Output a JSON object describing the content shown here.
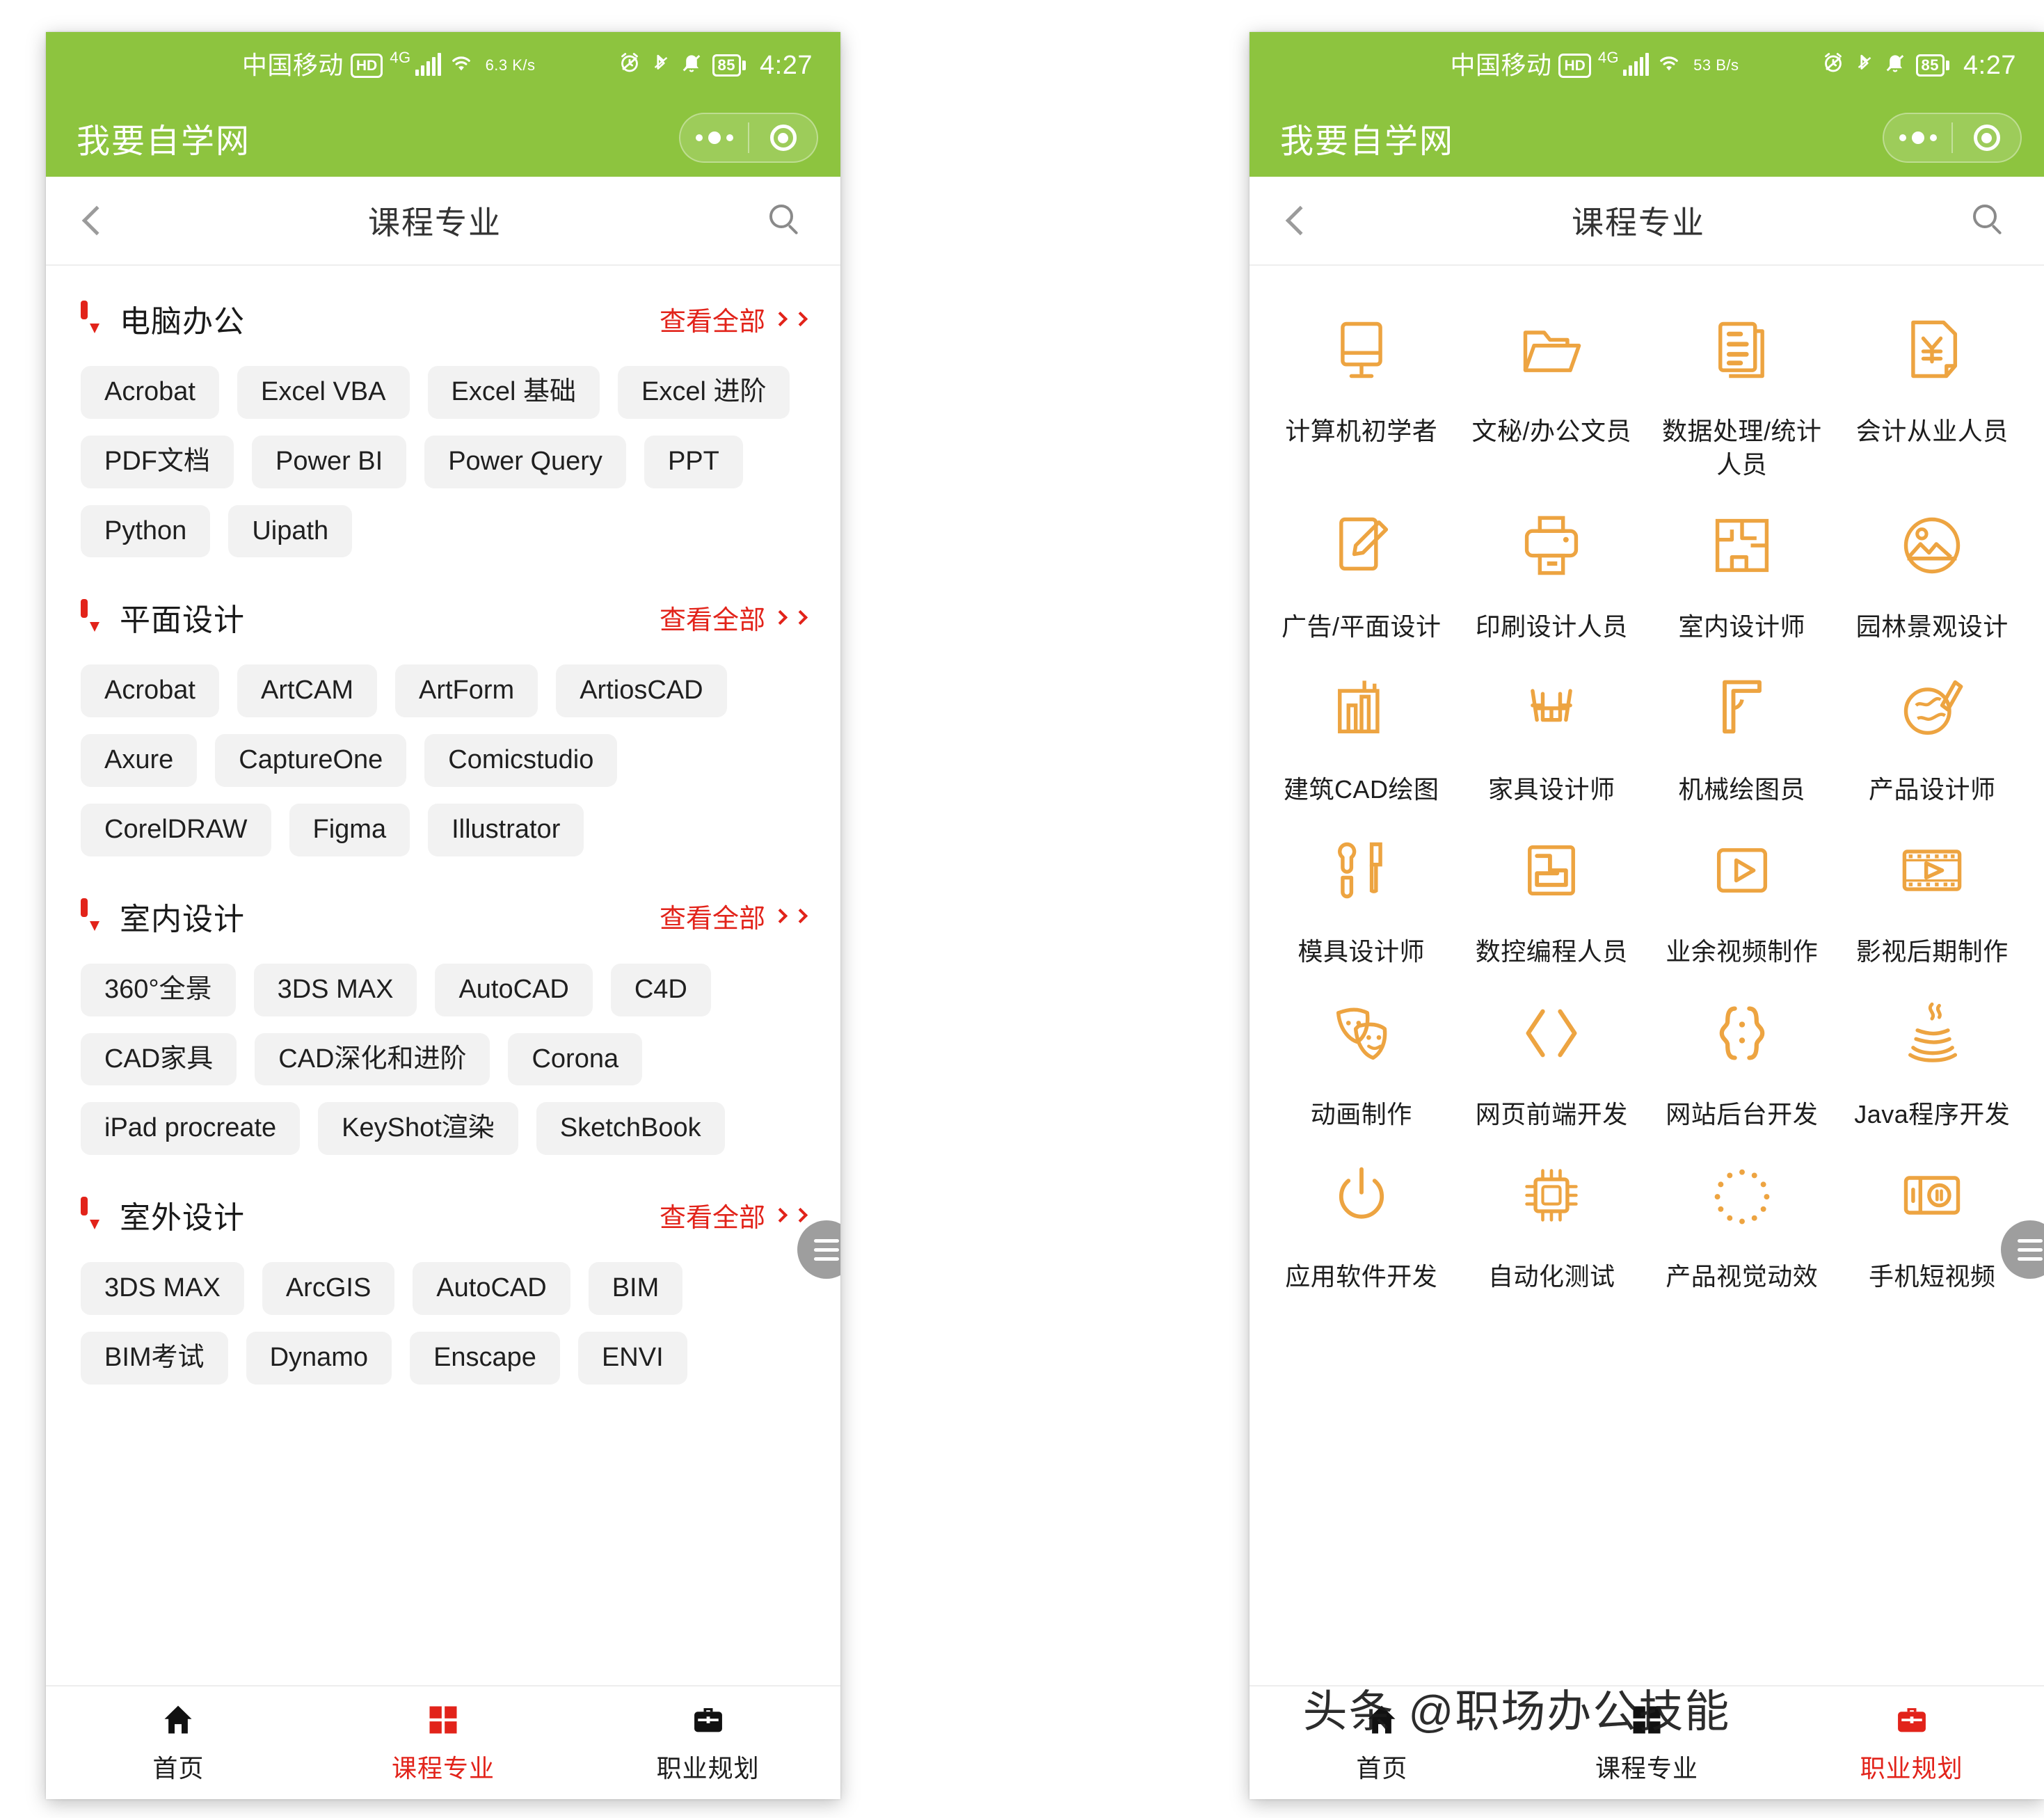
{
  "status_bar": {
    "carrier": "中国移动",
    "hd_badge": "HD",
    "network": "4G",
    "speed_left": "6.3\nK/s",
    "speed_right": "53\nB/s",
    "battery": "85",
    "time": "4:27",
    "icons": [
      "signal-bars-icon",
      "wifi-icon",
      "alarm-icon",
      "bluetooth-icon",
      "mute-icon",
      "battery-icon"
    ]
  },
  "app_bar": {
    "title": "我要自学网",
    "capsule": {
      "more_icon": "more-dots-icon",
      "target_icon": "target-circle-icon"
    }
  },
  "nav_bar": {
    "back_icon": "back-chevron-icon",
    "title": "课程专业",
    "search_icon": "search-icon"
  },
  "left_panel": {
    "see_all_label": "查看全部",
    "sections": [
      {
        "title": "电脑办公",
        "tags": [
          "Acrobat",
          "Excel VBA",
          "Excel 基础",
          "Excel 进阶",
          "PDF文档",
          "Power BI",
          "Power Query",
          "PPT",
          "Python",
          "Uipath"
        ]
      },
      {
        "title": "平面设计",
        "tags": [
          "Acrobat",
          "ArtCAM",
          "ArtForm",
          "ArtiosCAD",
          "Axure",
          "CaptureOne",
          "Comicstudio",
          "CorelDRAW",
          "Figma",
          "Illustrator"
        ]
      },
      {
        "title": "室内设计",
        "tags": [
          "360°全景",
          "3DS MAX",
          "AutoCAD",
          "C4D",
          "CAD家具",
          "CAD深化和进阶",
          "Corona",
          "iPad procreate",
          "KeyShot渲染",
          "SketchBook"
        ]
      },
      {
        "title": "室外设计",
        "tags": [
          "3DS MAX",
          "ArcGIS",
          "AutoCAD",
          "BIM",
          "BIM考试",
          "Dynamo",
          "Enscape",
          "ENVI"
        ]
      }
    ]
  },
  "right_panel": {
    "professions": [
      {
        "label": "计算机初学者",
        "icon": "monitor-icon"
      },
      {
        "label": "文秘/办公文员",
        "icon": "folder-icon"
      },
      {
        "label": "数据处理/统计人员",
        "icon": "document-list-icon"
      },
      {
        "label": "会计从业人员",
        "icon": "invoice-yuan-icon"
      },
      {
        "label": "广告/平面设计",
        "icon": "pencil-edit-icon"
      },
      {
        "label": "印刷设计人员",
        "icon": "printer-icon"
      },
      {
        "label": "室内设计师",
        "icon": "floorplan-icon"
      },
      {
        "label": "园林景观设计",
        "icon": "landscape-picture-icon"
      },
      {
        "label": "建筑CAD绘图",
        "icon": "buildings-chart-icon"
      },
      {
        "label": "家具设计师",
        "icon": "table-chairs-icon"
      },
      {
        "label": "机械绘图员",
        "icon": "set-square-icon"
      },
      {
        "label": "产品设计师",
        "icon": "sketch-pen-icon"
      },
      {
        "label": "模具设计师",
        "icon": "wrench-screwdriver-icon"
      },
      {
        "label": "数控编程人员",
        "icon": "cnc-path-icon"
      },
      {
        "label": "业余视频制作",
        "icon": "play-square-icon"
      },
      {
        "label": "影视后期制作",
        "icon": "film-strip-icon"
      },
      {
        "label": "动画制作",
        "icon": "theater-masks-icon"
      },
      {
        "label": "网页前端开发",
        "icon": "code-brackets-icon"
      },
      {
        "label": "网站后台开发",
        "icon": "curly-braces-icon"
      },
      {
        "label": "Java程序开发",
        "icon": "java-coffee-icon"
      },
      {
        "label": "应用软件开发",
        "icon": "power-button-icon"
      },
      {
        "label": "自动化测试",
        "icon": "chip-icon"
      },
      {
        "label": "产品视觉动效",
        "icon": "dotted-circle-icon"
      },
      {
        "label": "手机短视频",
        "icon": "media-player-icon"
      }
    ]
  },
  "tab_bar": {
    "left": [
      {
        "label": "首页",
        "icon": "home-icon",
        "active": false
      },
      {
        "label": "课程专业",
        "icon": "grid-icon",
        "active": true
      },
      {
        "label": "职业规划",
        "icon": "briefcase-icon",
        "active": false
      }
    ],
    "right": [
      {
        "label": "首页",
        "icon": "home-icon",
        "active": false
      },
      {
        "label": "课程专业",
        "icon": "grid-icon",
        "active": false
      },
      {
        "label": "职业规划",
        "icon": "briefcase-icon",
        "active": true
      }
    ]
  },
  "watermark": {
    "text": "头条 @职场办公技能"
  },
  "colors": {
    "brand_green": "#8dc43f",
    "accent_red": "#e2231a",
    "icon_orange": "#eda441",
    "tag_bg": "#f2f2f2"
  }
}
